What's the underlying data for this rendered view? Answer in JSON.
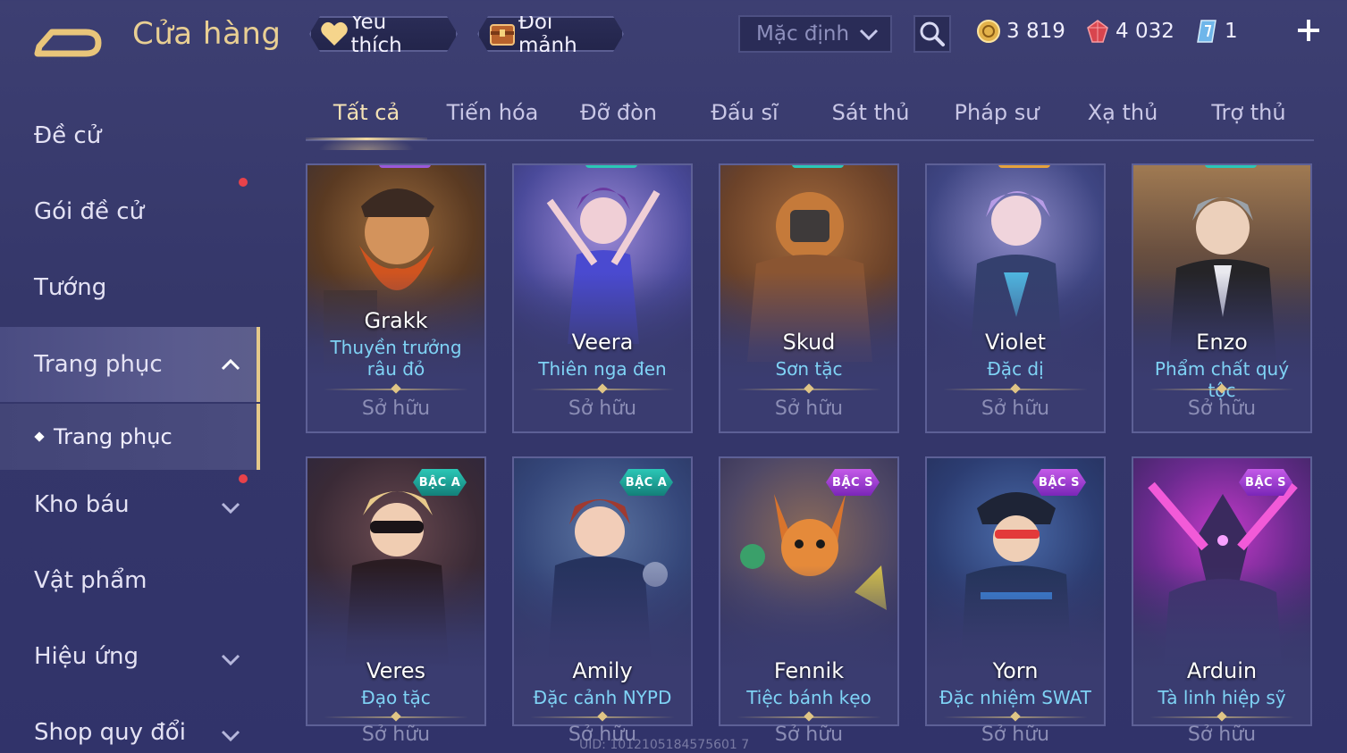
{
  "header": {
    "title": "Cửa hàng",
    "favorites_label": "Yêu thích",
    "exchange_label": "Đổi mảnh",
    "sort_selected": "Mặc định"
  },
  "currencies": {
    "gold": "3 819",
    "ruby": "4 032",
    "voucher": "1"
  },
  "sidebar": {
    "items": [
      {
        "label": "Đề cử"
      },
      {
        "label": "Gói đề cử"
      },
      {
        "label": "Tướng"
      },
      {
        "label": "Trang phục"
      },
      {
        "label": "Kho báu"
      },
      {
        "label": "Vật phẩm"
      },
      {
        "label": "Hiệu ứng"
      },
      {
        "label": "Shop quy đổi"
      }
    ],
    "sub_items": [
      {
        "label": "Trang phục"
      }
    ]
  },
  "tabs": [
    {
      "label": "Tất cả"
    },
    {
      "label": "Tiến hóa"
    },
    {
      "label": "Đỡ đòn"
    },
    {
      "label": "Đấu sĩ"
    },
    {
      "label": "Sát thủ"
    },
    {
      "label": "Pháp sư"
    },
    {
      "label": "Xạ thủ"
    },
    {
      "label": "Trợ thủ"
    }
  ],
  "skins": [
    {
      "hero": "Grakk",
      "skin": "Thuyền trưởng râu đỏ",
      "status": "Sở hữu"
    },
    {
      "hero": "Veera",
      "skin": "Thiên nga đen",
      "status": "Sở hữu"
    },
    {
      "hero": "Skud",
      "skin": "Sơn tặc",
      "status": "Sở hữu"
    },
    {
      "hero": "Violet",
      "skin": "Đặc dị",
      "status": "Sở hữu"
    },
    {
      "hero": "Enzo",
      "skin": "Phẩm chất quý tộc",
      "status": "Sở hữu"
    },
    {
      "hero": "Veres",
      "skin": "Đạo tặc",
      "status": "Sở hữu",
      "tier": "BẬC A"
    },
    {
      "hero": "Amily",
      "skin": "Đặc cảnh NYPD",
      "status": "Sở hữu",
      "tier": "BẬC A"
    },
    {
      "hero": "Fennik",
      "skin": "Tiệc bánh kẹo",
      "status": "Sở hữu",
      "tier": "BẬC S"
    },
    {
      "hero": "Yorn",
      "skin": "Đặc nhiệm SWAT",
      "status": "Sở hữu",
      "tier": "BẬC S"
    },
    {
      "hero": "Arduin",
      "skin": "Tà linh hiệp sỹ",
      "status": "Sở hữu",
      "tier": "BẬC S"
    }
  ],
  "footer": {
    "uid": "UID: 1012105184575601 7"
  },
  "colors": {
    "background": "#35376a",
    "accent_gold": "#e9cf93",
    "skin_name": "#7fd3f5",
    "tier_a": "#2bc7b6",
    "tier_s": "#b04ae0",
    "notification": "#e8424a"
  },
  "icons": {
    "back": "back-arrow-icon",
    "favorite": "heart-icon",
    "exchange": "chest-icon",
    "search": "search-icon",
    "gold": "gold-coin-icon",
    "ruby": "ruby-gem-icon",
    "voucher": "voucher-ticket-icon",
    "add": "plus-icon"
  }
}
